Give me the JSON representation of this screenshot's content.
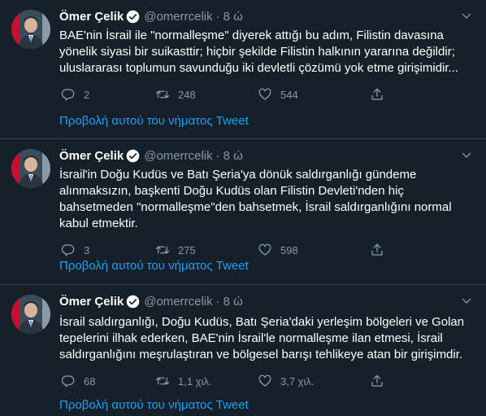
{
  "tweets": [
    {
      "name": "Ömer Çelik",
      "handle": "@omerrcelik",
      "separator": "·",
      "time": "8 ώ",
      "text": "BAE'nin İsrail ile \"normalleşme\" diyerek attığı bu adım, Filistin davasına\nyönelik siyasi bir suikasttir; hiçbir şekilde Filistin halkının yararına değildir;\nuluslararası toplumun savunduğu iki devletli çözümü yok etme girişimidir...",
      "replies": "2",
      "retweets": "248",
      "likes": "544",
      "thread_link": "Προβολή αυτού του νήματος Tweet"
    },
    {
      "name": "Ömer Çelik",
      "handle": "@omerrcelik",
      "separator": "·",
      "time": "8 ώ",
      "text": "İsrail'in Doğu Kudüs ve Batı Şeria'ya dönük saldırganlığı gündeme\nalınmaksızın, başkenti Doğu Kudüs olan Filistin Devleti'nden hiç\nbahsetmeden \"normalleşme\"den bahsetmek, İsrail saldırganlığını normal\nkabul etmektir.",
      "replies": "3",
      "retweets": "275",
      "likes": "598",
      "thread_link": "Προβολή αυτού του νήματος Tweet"
    },
    {
      "name": "Ömer Çelik",
      "handle": "@omerrcelik",
      "separator": "·",
      "time": "8 ώ",
      "text": "İsrail saldırganlığı, Doğu Kudüs, Batı Şeria'daki yerleşim bölgeleri ve Golan\ntepelerini ilhak ederken, BAE'nin İsrail'le normalleşme ilan etmesi, İsrail\nsaldırganlığını meşrulaştıran ve bölgesel barışı tehlikeye atan bir girişimdir.",
      "replies": "68",
      "retweets": "1,1 χιλ.",
      "likes": "3,7 χιλ.",
      "thread_link": "Προβολή αυτού του νήματος Tweet"
    }
  ],
  "colors": {
    "background": "#15202b",
    "text": "#ffffff",
    "muted": "#8899a6",
    "link": "#1da1f2",
    "divider": "#38444d",
    "verified": "#1da1f2"
  },
  "icons": [
    "avatar",
    "verified-icon",
    "chevron-down-icon",
    "reply-icon",
    "retweet-icon",
    "like-icon",
    "share-icon"
  ]
}
